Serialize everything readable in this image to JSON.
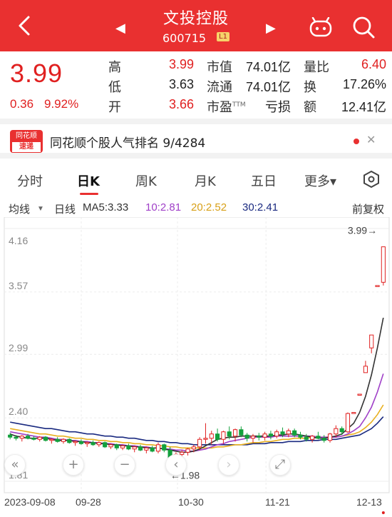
{
  "header": {
    "title": "文投控股",
    "code": "600715",
    "badge": "L1",
    "prev_arrow": "◀",
    "next_arrow": "▶"
  },
  "quote": {
    "price": "3.99",
    "change": "0.36",
    "change_pct": "9.92%",
    "high_label": "高",
    "high": "3.99",
    "low_label": "低",
    "low": "3.63",
    "open_label": "开",
    "open": "3.66",
    "mktcap_label": "市值",
    "mktcap": "74.01亿",
    "float_label": "流通",
    "float": "74.01亿",
    "pe_label": "市盈",
    "pe_tm": "TTM",
    "pe": "亏损",
    "volratio_label": "量比",
    "volratio": "6.40",
    "turnover_label": "换",
    "turnover": "17.26%",
    "amount_label": "额",
    "amount": "12.41亿"
  },
  "news": {
    "logo_top": "同花顺",
    "logo_bottom": "速递",
    "text": "同花顺个股人气排名 9/4284",
    "close": "✕"
  },
  "tabs": [
    {
      "label": "分时"
    },
    {
      "label": "日K"
    },
    {
      "label": "周K"
    },
    {
      "label": "月K"
    },
    {
      "label": "五日"
    },
    {
      "label": "更多▾"
    }
  ],
  "ma_bar": {
    "mode": "均线",
    "mode_arrow": "▼",
    "period": "日线",
    "ma5": "MA5:3.33",
    "ma10": "10:2.81",
    "ma20": "20:2.52",
    "ma30": "30:2.41",
    "adjust": "前复权"
  },
  "colors": {
    "up": "#e02020",
    "down": "#12a03c",
    "ma5": "#333333",
    "ma10": "#a040c8",
    "ma20": "#e8b020",
    "ma30": "#1a2a80"
  },
  "controls": {
    "rewind": "«",
    "zoom_in": "+",
    "zoom_out": "−",
    "left": "‹",
    "right": "›",
    "fullscreen": "⤢"
  },
  "chart_data": {
    "type": "candlestick",
    "y_ticks": [
      "4.16",
      "3.57",
      "2.99",
      "2.40",
      "1.81"
    ],
    "ylim": [
      1.81,
      4.16
    ],
    "x_labels": [
      "2023-09-08",
      "09-28",
      "10-30",
      "11-21",
      "12-13"
    ],
    "annotations": {
      "high_marker": "3.99→",
      "low_marker": "←1.98"
    },
    "candles": [
      [
        2.24,
        2.26,
        2.2,
        2.22
      ],
      [
        2.22,
        2.24,
        2.19,
        2.21
      ],
      [
        2.21,
        2.24,
        2.18,
        2.23
      ],
      [
        2.23,
        2.25,
        2.2,
        2.21
      ],
      [
        2.21,
        2.23,
        2.19,
        2.2
      ],
      [
        2.2,
        2.23,
        2.18,
        2.22
      ],
      [
        2.22,
        2.23,
        2.18,
        2.19
      ],
      [
        2.19,
        2.21,
        2.16,
        2.2
      ],
      [
        2.2,
        2.22,
        2.17,
        2.18
      ],
      [
        2.18,
        2.21,
        2.16,
        2.2
      ],
      [
        2.2,
        2.21,
        2.16,
        2.17
      ],
      [
        2.17,
        2.19,
        2.14,
        2.18
      ],
      [
        2.18,
        2.2,
        2.15,
        2.16
      ],
      [
        2.16,
        2.18,
        2.13,
        2.17
      ],
      [
        2.17,
        2.19,
        2.14,
        2.15
      ],
      [
        2.15,
        2.18,
        2.13,
        2.17
      ],
      [
        2.17,
        2.18,
        2.12,
        2.13
      ],
      [
        2.13,
        2.16,
        2.11,
        2.15
      ],
      [
        2.15,
        2.16,
        2.1,
        2.12
      ],
      [
        2.12,
        2.15,
        2.1,
        2.14
      ],
      [
        2.14,
        2.16,
        2.1,
        2.11
      ],
      [
        2.11,
        2.14,
        2.08,
        2.13
      ],
      [
        2.13,
        2.15,
        2.09,
        2.1
      ],
      [
        2.1,
        2.13,
        2.07,
        2.12
      ],
      [
        2.12,
        2.14,
        2.08,
        2.09
      ],
      [
        2.09,
        2.17,
        2.07,
        2.15
      ],
      [
        2.15,
        2.16,
        2.08,
        2.1
      ],
      [
        2.1,
        2.13,
        2.02,
        2.03
      ],
      [
        2.03,
        2.08,
        1.98,
        2.06
      ],
      [
        2.06,
        2.1,
        2.02,
        2.08
      ],
      [
        2.08,
        2.12,
        2.05,
        2.11
      ],
      [
        2.11,
        2.15,
        2.08,
        2.13
      ],
      [
        2.13,
        2.22,
        2.1,
        2.2
      ],
      [
        2.2,
        2.35,
        2.16,
        2.21
      ],
      [
        2.21,
        2.28,
        2.15,
        2.25
      ],
      [
        2.25,
        2.3,
        2.18,
        2.2
      ],
      [
        2.2,
        2.28,
        2.16,
        2.27
      ],
      [
        2.27,
        2.32,
        2.2,
        2.23
      ],
      [
        2.23,
        2.3,
        2.18,
        2.29
      ],
      [
        2.29,
        2.32,
        2.22,
        2.24
      ],
      [
        2.24,
        2.26,
        2.18,
        2.21
      ],
      [
        2.21,
        2.25,
        2.17,
        2.23
      ],
      [
        2.23,
        2.26,
        2.19,
        2.22
      ],
      [
        2.22,
        2.27,
        2.19,
        2.25
      ],
      [
        2.25,
        2.28,
        2.2,
        2.23
      ],
      [
        2.23,
        2.29,
        2.21,
        2.27
      ],
      [
        2.27,
        2.31,
        2.22,
        2.25
      ],
      [
        2.25,
        2.3,
        2.22,
        2.28
      ],
      [
        2.28,
        2.3,
        2.22,
        2.24
      ],
      [
        2.24,
        2.27,
        2.2,
        2.22
      ],
      [
        2.22,
        2.25,
        2.18,
        2.2
      ],
      [
        2.2,
        2.24,
        2.17,
        2.23
      ],
      [
        2.23,
        2.27,
        2.2,
        2.21
      ],
      [
        2.21,
        2.24,
        2.17,
        2.19
      ],
      [
        2.19,
        2.26,
        2.17,
        2.25
      ],
      [
        2.25,
        2.33,
        2.22,
        2.3
      ],
      [
        2.3,
        2.32,
        2.24,
        2.27
      ],
      [
        2.27,
        2.45,
        2.26,
        2.44
      ],
      [
        2.44,
        2.45,
        2.44,
        2.45
      ],
      [
        2.62,
        2.62,
        2.62,
        2.62
      ],
      [
        2.82,
        2.93,
        2.82,
        2.88
      ],
      [
        3.05,
        3.17,
        3.0,
        3.17
      ],
      [
        3.63,
        3.63,
        3.63,
        3.63
      ],
      [
        3.66,
        3.99,
        3.63,
        3.99
      ]
    ],
    "ma5": [
      2.25,
      2.23,
      2.22,
      2.21,
      2.21,
      2.21,
      2.21,
      2.2,
      2.19,
      2.19,
      2.19,
      2.18,
      2.18,
      2.17,
      2.17,
      2.16,
      2.16,
      2.15,
      2.15,
      2.14,
      2.14,
      2.13,
      2.13,
      2.12,
      2.12,
      2.12,
      2.11,
      2.1,
      2.09,
      2.08,
      2.08,
      2.09,
      2.11,
      2.14,
      2.17,
      2.2,
      2.21,
      2.22,
      2.22,
      2.23,
      2.23,
      2.23,
      2.23,
      2.23,
      2.23,
      2.24,
      2.24,
      2.25,
      2.25,
      2.24,
      2.23,
      2.22,
      2.21,
      2.21,
      2.22,
      2.23,
      2.25,
      2.3,
      2.35,
      2.45,
      2.6,
      2.8,
      3.05,
      3.33
    ],
    "ma10": [
      2.27,
      2.26,
      2.25,
      2.24,
      2.23,
      2.22,
      2.22,
      2.21,
      2.2,
      2.2,
      2.19,
      2.19,
      2.18,
      2.18,
      2.17,
      2.17,
      2.16,
      2.16,
      2.15,
      2.15,
      2.14,
      2.14,
      2.13,
      2.13,
      2.12,
      2.12,
      2.11,
      2.11,
      2.1,
      2.1,
      2.09,
      2.09,
      2.1,
      2.11,
      2.13,
      2.15,
      2.16,
      2.18,
      2.19,
      2.2,
      2.21,
      2.22,
      2.22,
      2.22,
      2.22,
      2.23,
      2.23,
      2.23,
      2.23,
      2.23,
      2.23,
      2.23,
      2.22,
      2.22,
      2.22,
      2.22,
      2.23,
      2.25,
      2.28,
      2.32,
      2.4,
      2.5,
      2.64,
      2.81
    ],
    "ma20": [
      2.3,
      2.29,
      2.28,
      2.27,
      2.26,
      2.25,
      2.25,
      2.24,
      2.23,
      2.23,
      2.22,
      2.21,
      2.21,
      2.2,
      2.2,
      2.19,
      2.19,
      2.18,
      2.18,
      2.17,
      2.17,
      2.16,
      2.16,
      2.15,
      2.15,
      2.14,
      2.14,
      2.13,
      2.13,
      2.12,
      2.12,
      2.12,
      2.12,
      2.12,
      2.12,
      2.13,
      2.13,
      2.14,
      2.15,
      2.15,
      2.16,
      2.17,
      2.17,
      2.18,
      2.18,
      2.19,
      2.2,
      2.2,
      2.21,
      2.21,
      2.21,
      2.22,
      2.22,
      2.22,
      2.22,
      2.22,
      2.23,
      2.24,
      2.25,
      2.27,
      2.31,
      2.36,
      2.43,
      2.52
    ],
    "ma30": [
      2.36,
      2.35,
      2.34,
      2.33,
      2.32,
      2.31,
      2.3,
      2.3,
      2.29,
      2.28,
      2.27,
      2.27,
      2.26,
      2.25,
      2.25,
      2.24,
      2.23,
      2.23,
      2.22,
      2.22,
      2.21,
      2.21,
      2.2,
      2.19,
      2.19,
      2.18,
      2.18,
      2.17,
      2.17,
      2.16,
      2.16,
      2.15,
      2.15,
      2.15,
      2.15,
      2.15,
      2.15,
      2.15,
      2.15,
      2.15,
      2.15,
      2.16,
      2.16,
      2.16,
      2.17,
      2.17,
      2.17,
      2.18,
      2.18,
      2.18,
      2.19,
      2.19,
      2.19,
      2.2,
      2.2,
      2.2,
      2.21,
      2.22,
      2.23,
      2.24,
      2.27,
      2.3,
      2.35,
      2.41
    ]
  }
}
